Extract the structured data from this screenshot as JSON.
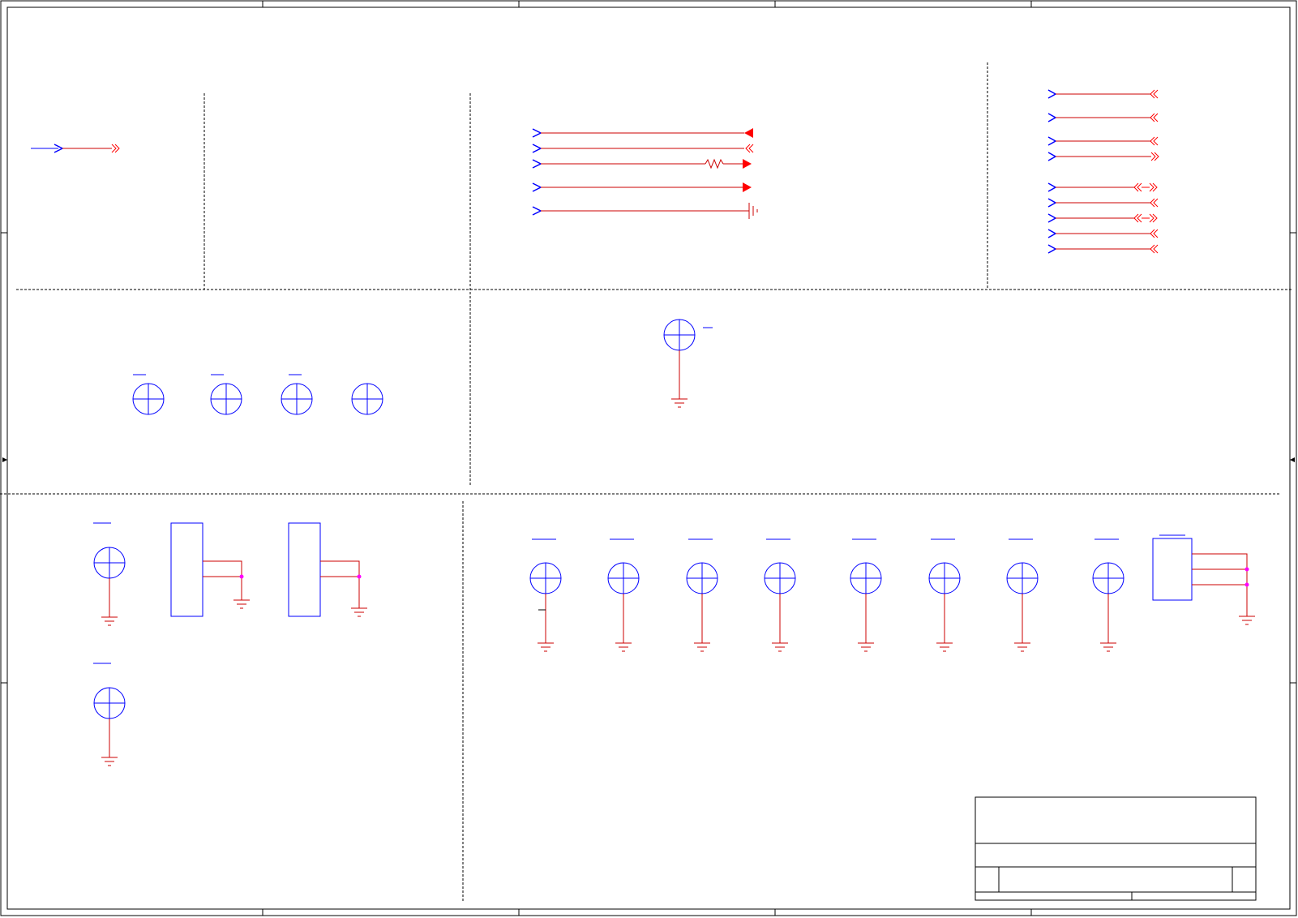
{
  "sheet": {
    "colors": {
      "frame": "#000000",
      "symbol_blue": "#0000ff",
      "wire_red": "#cc0000",
      "port_red": "#ff0000",
      "junction": "#ff00ff",
      "divider": "#000000"
    }
  },
  "title_block": {
    "title": "",
    "sheet_name": "",
    "size": "",
    "rev": ""
  },
  "icons": {
    "offpage_in": "offpage-connector-in-icon",
    "offpage_out": "offpage-connector-out-icon",
    "offpage_bidir": "offpage-connector-bidir-icon",
    "power": "power-arrow-icon",
    "ground": "ground-icon",
    "chassis": "chassis-ground-icon",
    "resistor": "resistor-icon",
    "mounting_hole": "mounting-hole-icon",
    "connector": "connector-block-icon"
  }
}
